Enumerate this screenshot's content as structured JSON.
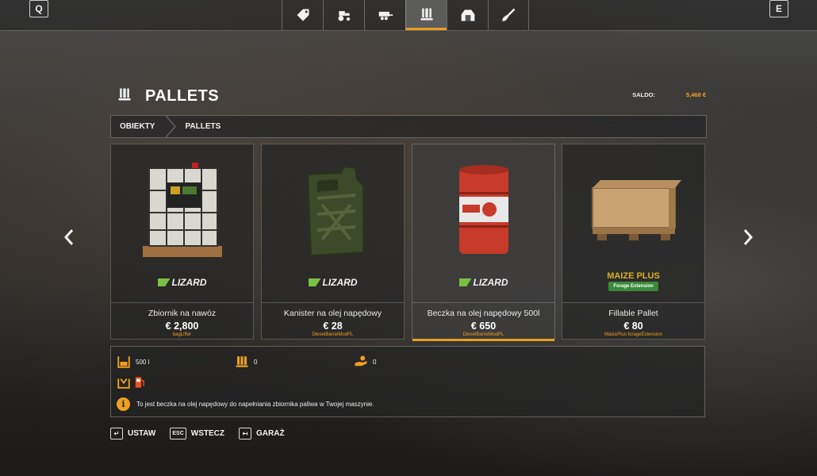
{
  "topbar": {
    "left_key": "Q",
    "right_key": "E",
    "tabs": [
      {
        "icon": "price-tag-icon",
        "active": false
      },
      {
        "icon": "tractor-icon",
        "active": false
      },
      {
        "icon": "trailer-icon",
        "active": false
      },
      {
        "icon": "pallet-icon",
        "active": true
      },
      {
        "icon": "barn-icon",
        "active": false
      },
      {
        "icon": "shovel-icon",
        "active": false
      }
    ]
  },
  "header": {
    "title": "PALLETS",
    "saldo_label": "SALDO:",
    "saldo_value": "5,468 €"
  },
  "breadcrumb": [
    "OBIEKTY",
    "PALLETS"
  ],
  "cards": [
    {
      "name": "Zbiornik na nawóz",
      "price": "€ 2,800",
      "mod": "bagLifter",
      "brand": "LIZARD",
      "image": "ibc-tank-icon",
      "selected": false
    },
    {
      "name": "Kanister na olej napędowy",
      "price": "€ 28",
      "mod": "DieselBarrelModPL",
      "brand": "LIZARD",
      "image": "jerrycan-icon",
      "selected": false
    },
    {
      "name": "Beczka na olej napędowy 500l",
      "price": "€ 650",
      "mod": "DieselBarrelModPL",
      "brand": "LIZARD",
      "image": "oil-barrel-icon",
      "selected": true
    },
    {
      "name": "Fillable Pallet",
      "price": "€ 80",
      "mod": "MaizePlus forageExtension",
      "brand": "MAIZE PLUS",
      "brand_sub": "Forage Extension",
      "image": "wooden-pallet-icon",
      "selected": false
    }
  ],
  "details": {
    "capacity": "500 l",
    "pallets": "0",
    "cost": "0",
    "description": "To jest beczka na olej napędowy do napełniania zbiornika paliwa w Twojej maszynie."
  },
  "footer": [
    {
      "key": "↵",
      "label": "USTAW"
    },
    {
      "key": "ESC",
      "label": "WSTECZ"
    },
    {
      "key": "↤",
      "label": "GARAŻ"
    }
  ],
  "colors": {
    "accent": "#e8a020",
    "lizard_green": "#7ac043"
  }
}
